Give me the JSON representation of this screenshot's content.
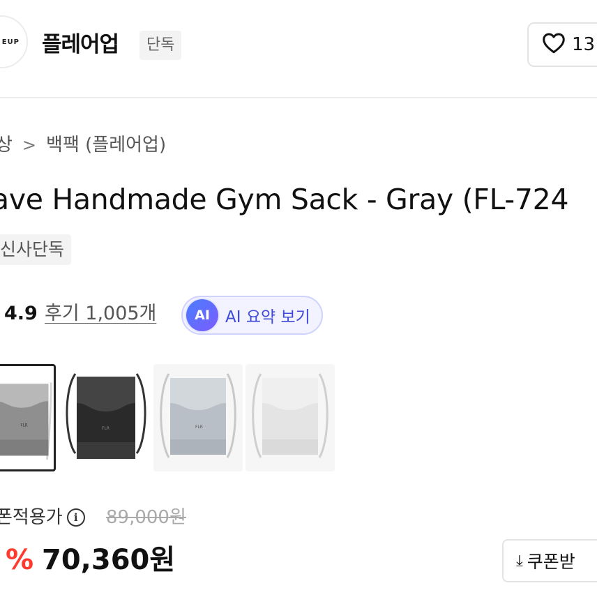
{
  "header": {
    "logo_text": "EUP",
    "brand_name": "플레어업",
    "exclusive_tag": "단독",
    "like_count": "13"
  },
  "breadcrumb": {
    "parent": "상",
    "current": "백팩 (플레어업)"
  },
  "product": {
    "title": "ave Handmade Gym Sack - Gray (FL-724",
    "tag": "신사단독",
    "rating": "4.9",
    "review_link": "후기 1,005개",
    "ai_badge": "AI",
    "ai_summary_label": "AI 요약 보기",
    "thumbnails": [
      {
        "color": "gray",
        "selected": true
      },
      {
        "color": "black",
        "selected": false
      },
      {
        "color": "light-blue-gray",
        "selected": false
      },
      {
        "color": "white",
        "selected": false
      }
    ]
  },
  "price": {
    "coupon_label": "폰적용가",
    "info_icon": "i",
    "original_price": "89,000원",
    "discount": "%",
    "sale_price": "70,360원",
    "coupon_button": "쿠폰받"
  },
  "colors": {
    "discount_red": "#ff3b30",
    "ai_accent": "#3f4bd6"
  }
}
